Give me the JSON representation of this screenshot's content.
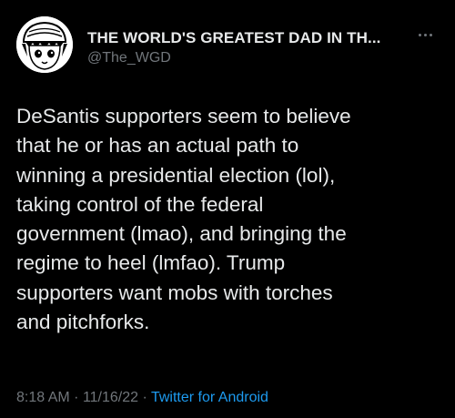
{
  "tweet": {
    "author": {
      "display_name": "THE WORLD'S GREATEST DAD IN TH...",
      "handle": "@The_WGD",
      "avatar_icon": "cartoon-avatar-icon"
    },
    "more_icon": "more-options-icon",
    "text": "DeSantis supporters seem to believe\nthat he or has an actual path to\nwinning a presidential election (lol),\ntaking control of the federal\ngovernment (lmao), and bringing the\nregime to heel (lmfao). Trump\nsupporters want mobs with torches\nand pitchforks.",
    "time": "8:18 AM",
    "separator": "·",
    "date": "11/16/22",
    "source": "Twitter for Android"
  },
  "colors": {
    "background": "#000000",
    "primary_text": "#e7e9ea",
    "secondary_text": "#71767b",
    "link": "#1d9bf0"
  }
}
